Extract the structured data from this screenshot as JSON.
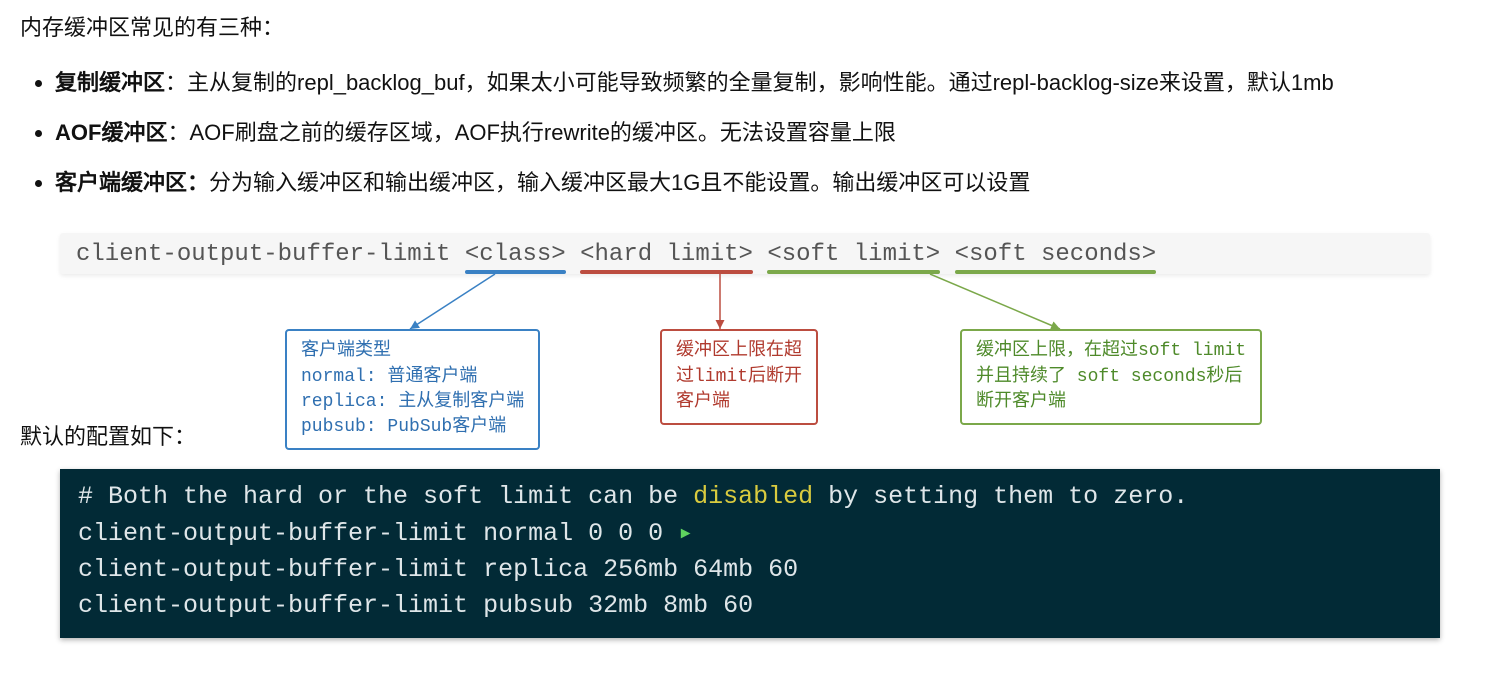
{
  "intro": "内存缓冲区常见的有三种：",
  "bullets": [
    {
      "title": "复制缓冲区",
      "colon": "：",
      "text": "主从复制的repl_backlog_buf，如果太小可能导致频繁的全量复制，影响性能。通过repl-backlog-size来设置，默认1mb"
    },
    {
      "title": "AOF缓冲区",
      "colon": "：",
      "text": "AOF刷盘之前的缓存区域，AOF执行rewrite的缓冲区。无法设置容量上限"
    },
    {
      "title": "客户端缓冲区：",
      "colon": "",
      "text": "分为输入缓冲区和输出缓冲区，输入缓冲区最大1G且不能设置。输出缓冲区可以设置"
    }
  ],
  "codebar": {
    "cmd": "client-output-buffer-limit ",
    "class": "<class>",
    "hard": "<hard limit>",
    "soft": "<soft limit>",
    "sec": "<soft seconds>"
  },
  "callouts": {
    "blue": "客户端类型\nnormal: 普通客户端\nreplica: 主从复制客户端\npubsub: PubSub客户端",
    "red": "缓冲区上限在超\n过limit后断开\n客户端",
    "green": "缓冲区上限，在超过soft limit\n并且持续了 soft seconds秒后\n断开客户端"
  },
  "default_label": "默认的配置如下：",
  "terminal": {
    "l1a": "# Both the hard or the soft limit can be ",
    "l1b": "disabled",
    "l1c": " by setting them to zero.",
    "l2": "client-output-buffer-limit normal 0 0 0 ",
    "l3": "client-output-buffer-limit replica 256mb 64mb 60",
    "l4": "client-output-buffer-limit pubsub 32mb 8mb 60"
  }
}
